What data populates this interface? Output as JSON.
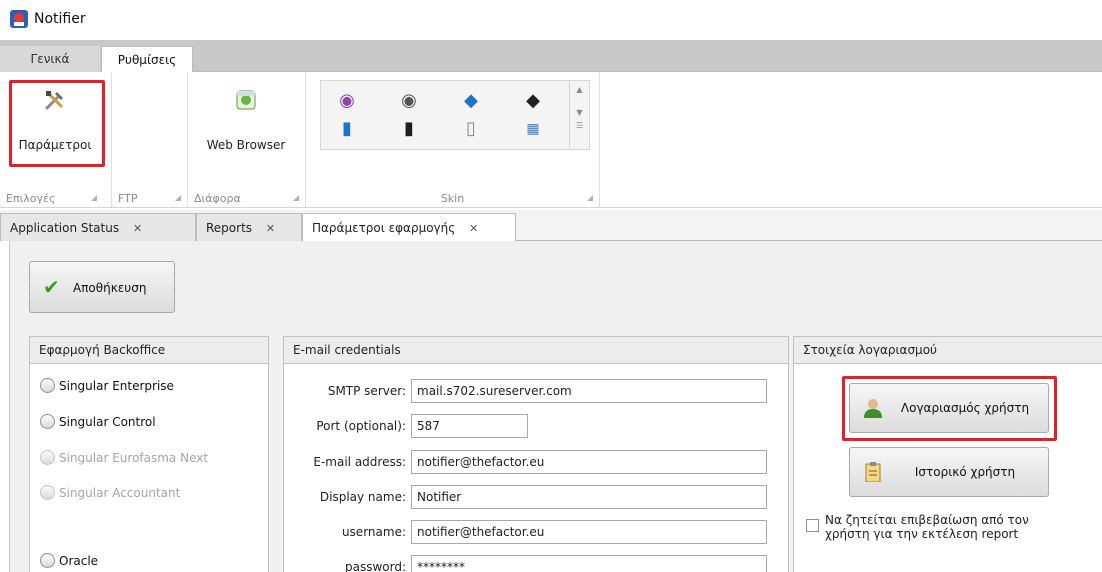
{
  "window": {
    "title": "Notifier"
  },
  "ribbon": {
    "tabs": [
      {
        "label": "Γενικά"
      },
      {
        "label": "Ρυθμίσεις"
      }
    ],
    "groups": {
      "options": {
        "label": "Επιλογές",
        "button": "Παράμετροι"
      },
      "ftp": {
        "label": "FTP"
      },
      "misc": {
        "label": "Διάφορα",
        "button": "Web Browser"
      },
      "skin": {
        "label": "Skin"
      }
    }
  },
  "doc_tabs": [
    {
      "label": "Application Status",
      "close": "✕"
    },
    {
      "label": "Reports",
      "close": "✕"
    },
    {
      "label": "Παράμετροι εφαρμογής",
      "close": "✕"
    }
  ],
  "toolbar": {
    "save_label": "Αποθήκευση"
  },
  "backoffice": {
    "title": "Εφαρμογή Backoffice",
    "options": [
      {
        "label": "Singular Enterprise"
      },
      {
        "label": "Singular Control"
      },
      {
        "label": "Singular Eurofasma Next"
      },
      {
        "label": "Singular Accountant"
      },
      {
        "label": "Oracle"
      }
    ]
  },
  "email": {
    "title": "E-mail credentials",
    "smtp_label": "SMTP server:",
    "smtp_value": "mail.s702.sureserver.com",
    "port_label": "Port (optional):",
    "port_value": "587",
    "address_label": "E-mail address:",
    "address_value": "notifier@thefactor.eu",
    "display_label": "Display name:",
    "display_value": "Notifier",
    "username_label": "username:",
    "username_value": "notifier@thefactor.eu",
    "password_label": "password:",
    "password_value": "********"
  },
  "account": {
    "title": "Στοιχεία λογαριασμού",
    "user_account_button": "Λογαριασμός χρήστη",
    "user_history_button": "Ιστορικό χρήστη",
    "confirm_label_1": "Να ζητείται επιβεβαίωση από τον",
    "confirm_label_2": "χρήστη για την εκτέλεση report"
  },
  "colors": {
    "highlight": "#e2202b",
    "panel_bg": "#f0f0f0",
    "ribbon_tabs_bg": "#c8c8c8"
  }
}
